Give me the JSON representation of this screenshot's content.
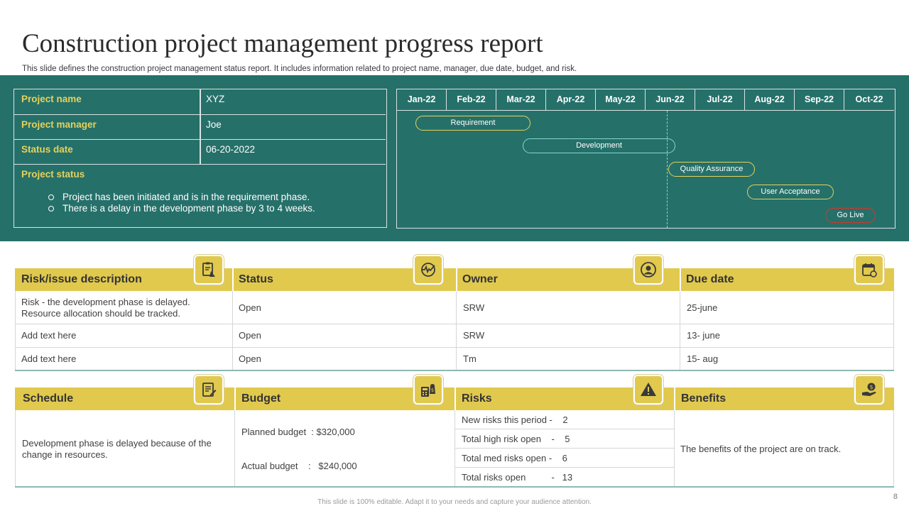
{
  "header": {
    "title": "Construction project management progress report",
    "subtitle": "This slide defines the  construction project management status report. It includes information related to project name, manager, due date, budget, and risk."
  },
  "project_info": {
    "name_label": "Project name",
    "name_value": "XYZ",
    "manager_label": "Project manager",
    "manager_value": "Joe",
    "date_label": "Status date",
    "date_value": "06-20-2022",
    "status_label": "Project status",
    "status_items": [
      "Project has been initiated and is in the requirement  phase.",
      "There  is a delay in the development  phase by 3 to 4 weeks."
    ]
  },
  "gantt": {
    "months": [
      "Jan-22",
      "Feb-22",
      "Mar-22",
      "Apr-22",
      "May-22",
      "Jun-22",
      "Jul-22",
      "Aug-22",
      "Sep-22",
      "Oct-22"
    ],
    "phases": [
      {
        "label": "Requirement",
        "color": "#e5d25a"
      },
      {
        "label": "Development",
        "color": "#7fd8cf"
      },
      {
        "label": "Quality Assurance",
        "color": "#e5d25a"
      },
      {
        "label": "User Acceptance",
        "color": "#e5d25a"
      },
      {
        "label": "Go Live",
        "color": "#d9342b"
      }
    ]
  },
  "risk_table": {
    "headers": [
      "Risk/issue description",
      "Status",
      "Owner",
      "Due date"
    ],
    "icons": [
      "risk-report-icon",
      "status-pulse-icon",
      "owner-icon",
      "calendar-icon"
    ],
    "rows": [
      {
        "description_l1": "Risk - the development  phase is delayed.",
        "description_l2": "Resource  allocation should be tracked.",
        "status": "Open",
        "owner": "SRW",
        "due": "25-june"
      },
      {
        "description_l1": "Add text here",
        "description_l2": "",
        "status": "Open",
        "owner": "SRW",
        "due": "13- june"
      },
      {
        "description_l1": "Add text here",
        "description_l2": "",
        "status": "Open",
        "owner": "Tm",
        "due": "15- aug"
      }
    ]
  },
  "summary_table": {
    "headers": [
      "Schedule",
      "Budget",
      "Risks",
      "Benefits"
    ],
    "icons": [
      "schedule-icon",
      "budget-calculator-icon",
      "warning-icon",
      "benefits-icon"
    ],
    "schedule_l1": "Development  phase is delayed because of  the",
    "schedule_l2": "change in resources.",
    "budget_planned": "Planned budget  : $320,000",
    "budget_actual": "Actual budget    :   $240,000",
    "risks": [
      "New risks this period -    2",
      "Total high risk open    -    5",
      "Total med risks open -    6",
      "Total risks open          -   13"
    ],
    "benefits": "The  benefits of the project are on track."
  },
  "footer": {
    "note": "This slide is 100% editable.  Adapt it to your  needs and capture your audience attention.",
    "page_number": "8"
  },
  "colors": {
    "band": "#26706a",
    "header_yellow": "#e1c94e",
    "label_yellow": "#e5d25a",
    "go_live_red": "#d9342b"
  }
}
